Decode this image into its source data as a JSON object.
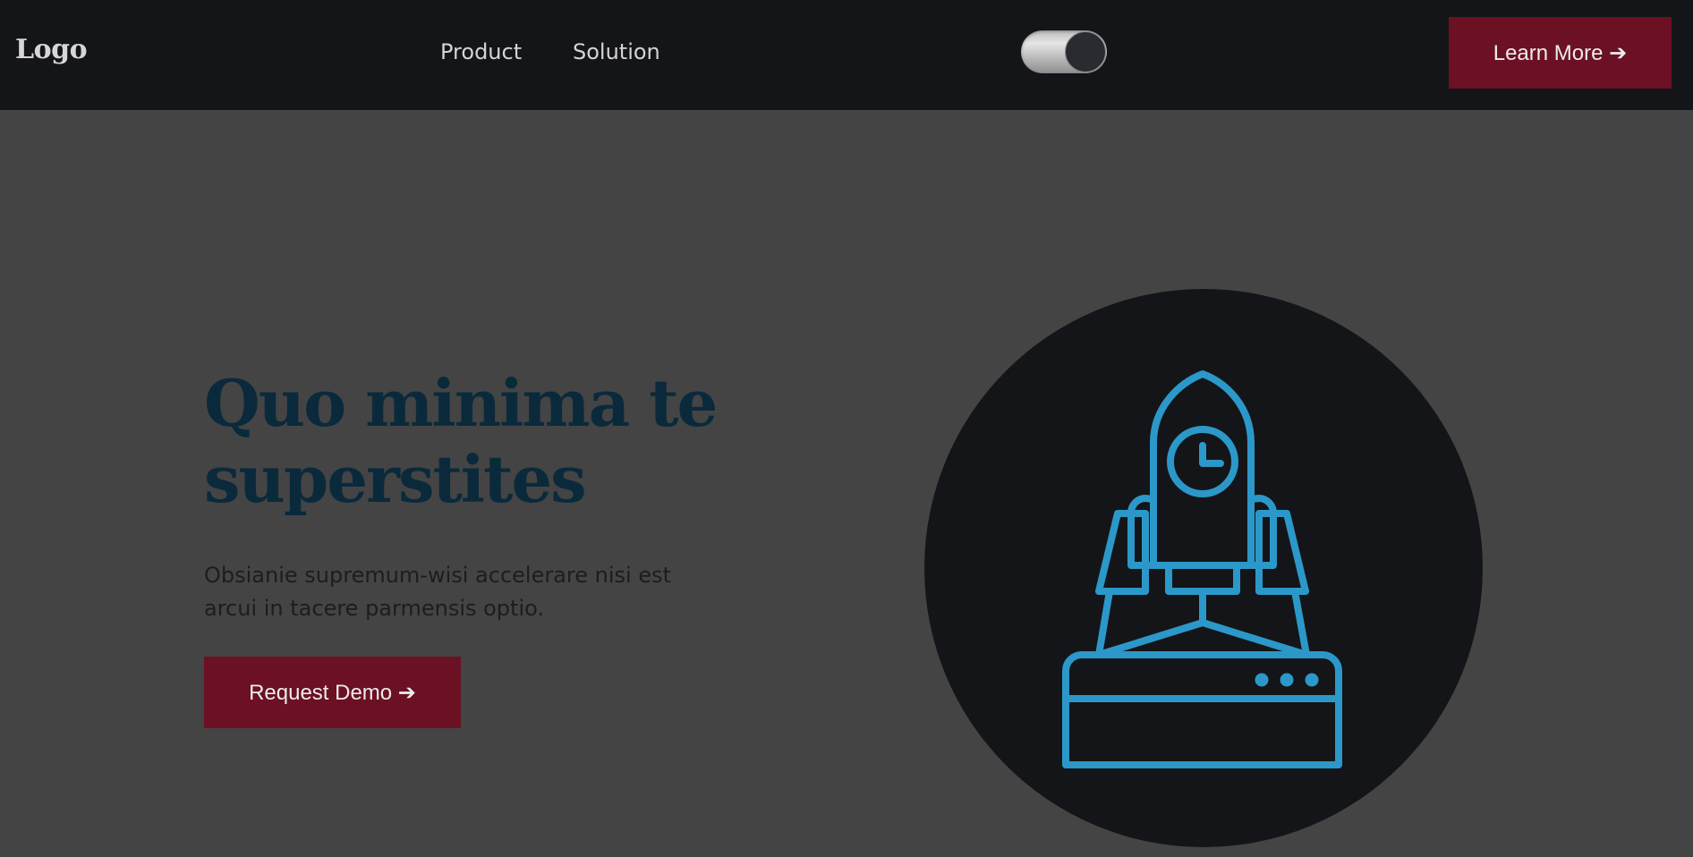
{
  "header": {
    "logo": "Logo",
    "nav": [
      {
        "label": "Product"
      },
      {
        "label": "Solution"
      }
    ],
    "theme_toggle_on": true,
    "cta_label": "Learn More ➔"
  },
  "hero": {
    "title": "Quo minima te superstites",
    "description": "Obsianie supremum-wisi accelerare nisi est arcui in tacere parmensis optio.",
    "cta_label": "Request Demo ➔",
    "illustration_icon": "rocket-launch-icon"
  },
  "colors": {
    "nav_bg": "#141518",
    "page_bg": "#444444",
    "accent": "#6c1023",
    "title": "#0a2a3c",
    "icon": "#2b98c9"
  }
}
